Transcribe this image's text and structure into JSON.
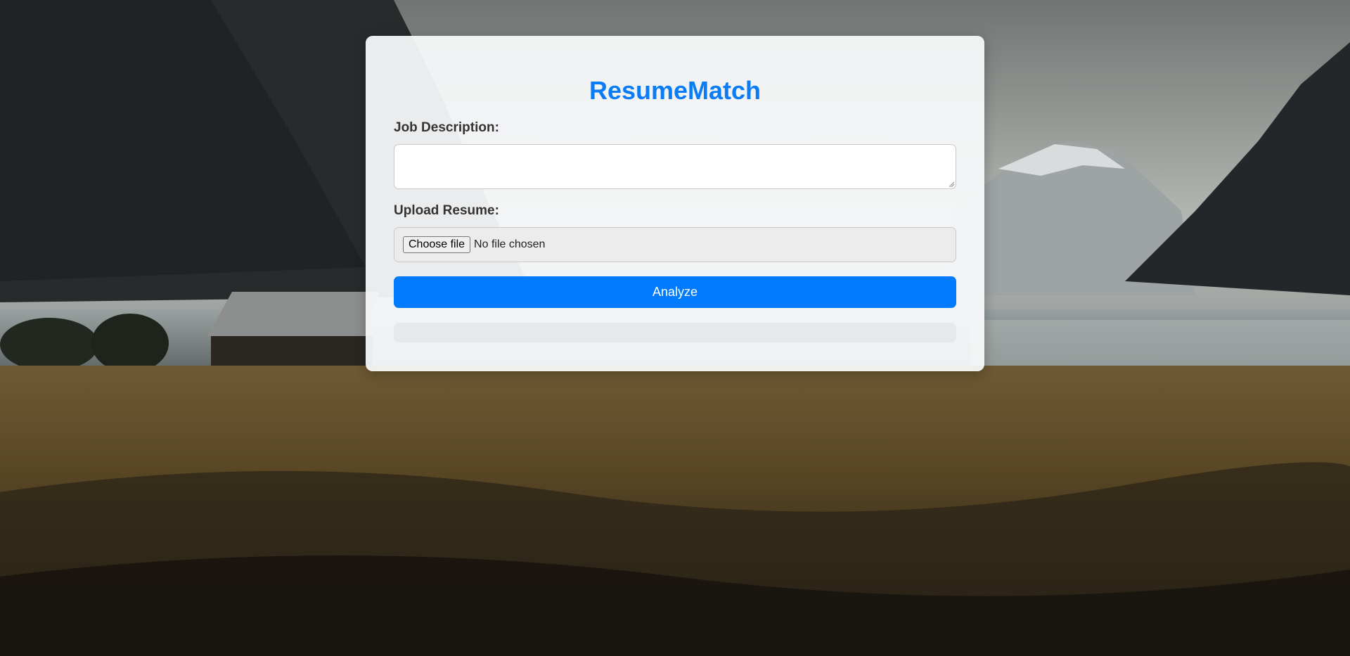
{
  "app": {
    "title": "ResumeMatch"
  },
  "form": {
    "job_description_label": "Job Description:",
    "job_description_value": "",
    "upload_label": "Upload Resume:",
    "choose_file_label": "Choose file",
    "no_file_text": "No file chosen",
    "analyze_label": "Analyze"
  },
  "result": {
    "text": ""
  },
  "colors": {
    "accent": "#007bff",
    "title": "#0a7cf5",
    "card_background": "#f8f9fa",
    "result_background": "#e6e9ec"
  },
  "background": {
    "description_icon": "landscape-photo"
  }
}
